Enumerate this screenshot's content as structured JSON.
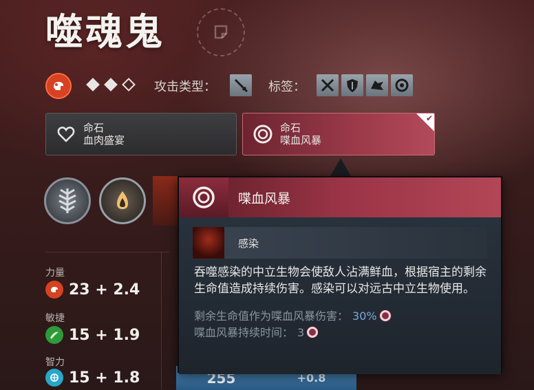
{
  "hero": {
    "name": "噬魂鬼",
    "complexity_filled": 2,
    "complexity_total": 3,
    "attack_type_label": "攻击类型：",
    "tags_label": "标签：",
    "primary_attribute_icon": "strength-fist-icon",
    "attack_type_icon": "melee-sword-icon",
    "tag_icons": [
      "crossed-swords-icon",
      "shield-icon",
      "wolf-head-icon",
      "gear-swirl-icon"
    ]
  },
  "facets": [
    {
      "line1": "命石",
      "line2": "血肉盛宴",
      "icon": "heart-icon",
      "selected": false
    },
    {
      "line1": "命石",
      "line2": "喋血风暴",
      "icon": "blood-ring-icon",
      "selected": true
    }
  ],
  "abilities": [
    "tree-rune-icon",
    "drop-flame-icon",
    "hero-portrait-icon"
  ],
  "stats": {
    "strength": {
      "label": "力量",
      "value": "23 + 2.4",
      "color": "#d64222"
    },
    "agility": {
      "label": "敏捷",
      "value": "15 + 1.9",
      "color": "#2e9a3a"
    },
    "intelligence": {
      "label": "智力",
      "value": "15 + 1.8",
      "color": "#2aa6c8"
    }
  },
  "bottom_bar": {
    "value": "255",
    "regen": "+0.8"
  },
  "tooltip": {
    "title": "喋血风暴",
    "sub_title": "感染",
    "description": "吞噬感染的中立生物会使敌人沾满鲜血，根据宿主的剩余生命值造成持续伤害。感染可以对远古中立生物使用。",
    "stat1_label": "剩余生命值作为喋血风暴伤害：",
    "stat1_value": "30%",
    "stat2_label": "喋血风暴持续时间：",
    "stat2_value": "3"
  }
}
